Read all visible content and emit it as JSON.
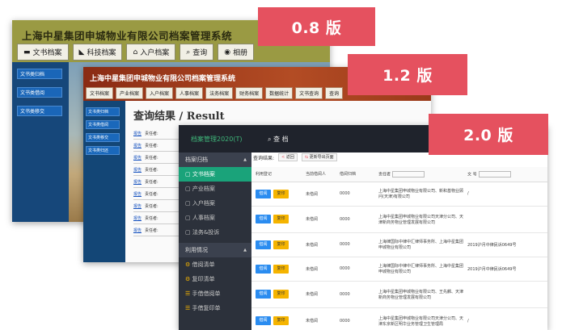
{
  "v08": {
    "title": "上海中星集团申城物业有限公司档案管理系统",
    "nav": [
      {
        "icon": "cards-icon",
        "label": "文书档案"
      },
      {
        "icon": "ruler-icon",
        "label": "科技档案"
      },
      {
        "icon": "home-icon",
        "label": "入户档案"
      },
      {
        "icon": "search-icon",
        "label": "查询"
      },
      {
        "icon": "camera-icon",
        "label": "相册"
      }
    ],
    "side": [
      "文书类归档",
      "文书类借阅",
      "文书类移交"
    ]
  },
  "v12": {
    "title": "上海中星集团申城物业有限公司档案管理系统",
    "nav": [
      "文书档案",
      "产业档案",
      "入户档案",
      "人事档案",
      "法务档案",
      "财务档案",
      "数据统计",
      "文书查询",
      "查询"
    ],
    "side": [
      "文书类归档",
      "文书类借阅",
      "文书类移交",
      "文书类归还"
    ],
    "result_title": "查询结果 / Result",
    "row_link": "报告",
    "row_label": "责任者:",
    "row_count": 9
  },
  "v20": {
    "logo": "档案管理2020(T)",
    "query": "查 档",
    "side_sections": [
      {
        "label": "档案归档",
        "items": [
          "文书档案",
          "产业档案",
          "入户档案",
          "人事档案",
          "法务&投诉"
        ]
      },
      {
        "label": "利用情况",
        "items": [
          "借阅清单",
          "复印清单",
          "手借借阅单",
          "手借复印单"
        ]
      }
    ],
    "active_item": "文书档案",
    "topbar": {
      "label": "查询结果:",
      "back": "返回",
      "export": "更新导出页面"
    },
    "columns": [
      "利用登记",
      "当前借阅人",
      "借阅归档",
      "责任者",
      "文 号"
    ],
    "column_filter_placeholders": [
      "请选责任者",
      "请选文号"
    ],
    "btn_borrow": "借阅",
    "btn_copy": "复印",
    "rows": [
      {
        "borrower": "未借阅",
        "count": "0000",
        "responsible": "上海中星集团申城物业有限公司、新和基物业顾问(天津)有限公司",
        "doc_no": "/"
      },
      {
        "borrower": "未借阅",
        "count": "0000",
        "responsible": "上海中星集团申城物业有限公司天津分公司、天津新商务物业管理发展有限公司",
        "doc_no": ""
      },
      {
        "borrower": "未借阅",
        "count": "0000",
        "responsible": "上海律国际中律中汇律师事务所、上海中星集团申城物业有限公司",
        "doc_no": "2019沪月中律民诉0649号"
      },
      {
        "borrower": "未借阅",
        "count": "0000",
        "responsible": "上海律国际中律中汇律师事务所、上海中星集团申城物业有限公司",
        "doc_no": "2019沪月中律民诉0649号"
      },
      {
        "borrower": "未借阅",
        "count": "0000",
        "responsible": "上海中星集团申城物业有限公司、王先麟、天津新商务物业管理发展有限公司",
        "doc_no": ""
      },
      {
        "borrower": "未借阅",
        "count": "0000",
        "responsible": "上海中星集团申城物业有限公司天津分公司、天津东京新区明华业务管理卫生管理局",
        "doc_no": "/"
      }
    ]
  },
  "tags": [
    "0.8 版",
    "1.2 版",
    "2.0 版"
  ]
}
